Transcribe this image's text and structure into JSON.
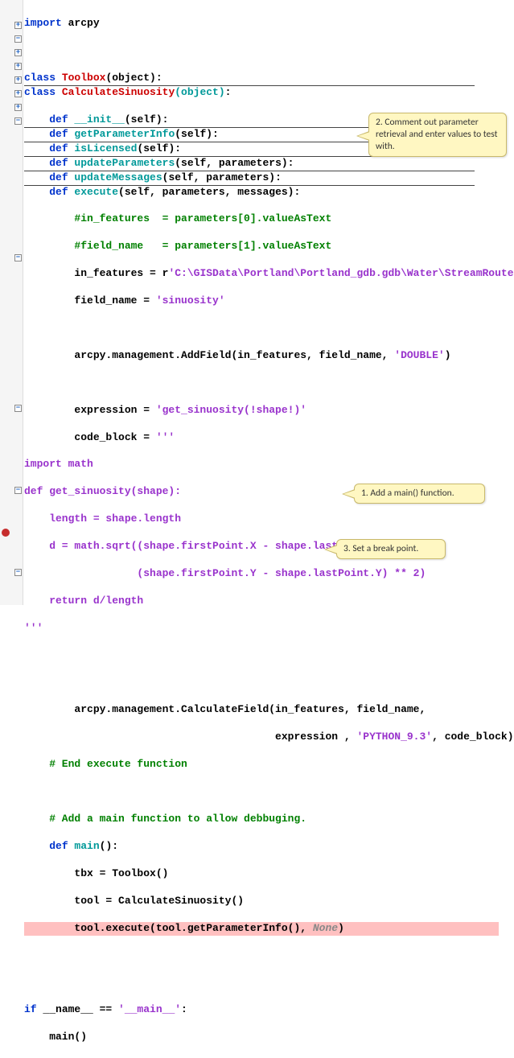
{
  "lines": {
    "l1_import": "import",
    "l1_mod": " arcpy",
    "l3_class": "class",
    "l3_name": " Toolbox",
    "l3_rest": "(object):",
    "l4_class": "class",
    "l4_name": " CalculateSinuosity",
    "l4_obj": "(object)",
    "l4_end": ":",
    "l5_def": "def",
    "l5_fn": " __init__",
    "l5_args": "(self):",
    "l6_def": "def",
    "l6_fn": " getParameterInfo",
    "l6_args": "(self):",
    "l7_def": "def",
    "l7_fn": " isLicensed",
    "l7_args": "(self):",
    "l8_def": "def",
    "l8_fn": " updateParameters",
    "l8_args": "(self, parameters):",
    "l9_def": "def",
    "l9_fn": " updateMessages",
    "l9_args": "(self, parameters):",
    "l10_def": "def",
    "l10_fn": " execute",
    "l10_args": "(self, parameters, messages):",
    "l11": "        #in_features  = parameters[0].valueAsText",
    "l12": "        #field_name   = parameters[1].valueAsText",
    "l13a": "        in_features = r",
    "l13b": "'C:\\GISData\\Portland\\Portland_gdb.gdb\\Water\\StreamRoute'",
    "l14a": "        field_name = ",
    "l14b": "'sinuosity'",
    "l16a": "        arcpy.management.AddField(in_features, field_name, ",
    "l16b": "'DOUBLE'",
    "l16c": ")",
    "l18a": "        expression = ",
    "l18b": "'get_sinuosity(!shape!)'",
    "l19a": "        code_block = ",
    "l19b": "'''",
    "l20": "import math",
    "l21": "def get_sinuosity(shape):",
    "l22": "    length = shape.length",
    "l23": "    d = math.sqrt((shape.firstPoint.X - shape.lastPoint.X) ** 2 +",
    "l24": "                  (shape.firstPoint.Y - shape.lastPoint.Y) ** 2)",
    "l25": "    return d/length",
    "l26": "'''",
    "l28": "        arcpy.management.CalculateField(in_features, field_name,",
    "l29a": "                                        expression , ",
    "l29b": "'PYTHON_9.3'",
    "l29c": ", code_block)",
    "l30": "    # End execute function",
    "l32": "    # Add a main function to allow debbuging.",
    "l33_def": "def",
    "l33_fn": " main",
    "l33_args": "():",
    "l34": "        tbx = Toolbox()",
    "l35": "        tool = CalculateSinuosity()",
    "l36a": "        tool.execute(tool.getParameterInfo(), ",
    "l36b": "None",
    "l36c": ")",
    "l38a": "if",
    "l38b": " __name__ == ",
    "l38c": "'__main__'",
    "l38d": ":",
    "l39": "    main()"
  },
  "callouts": {
    "c1": "1. Add a main() function.",
    "c2": "2. Comment out parameter retrieval and enter values to test with.",
    "c3": "3. Set a break point."
  },
  "indent1": "    ",
  "indent2": "        "
}
